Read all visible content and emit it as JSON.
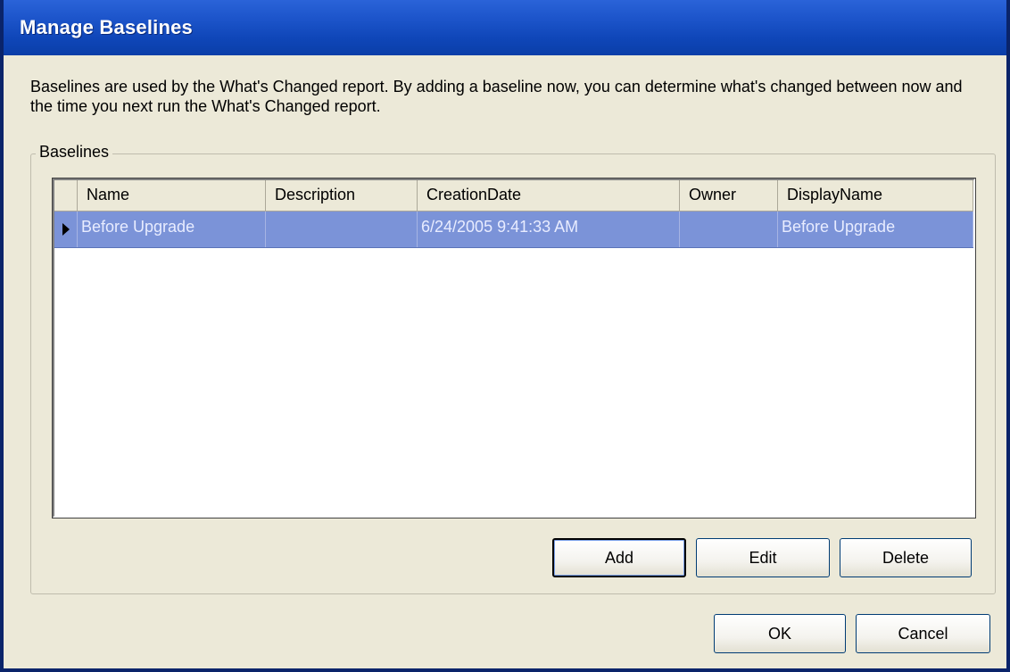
{
  "window": {
    "title": "Manage Baselines"
  },
  "intro": {
    "text": "Baselines are used by the What's Changed report.  By adding a baseline now, you can determine what's changed between now and the time you next run the What's Changed report."
  },
  "baselines_group": {
    "label": "Baselines",
    "columns": [
      "Name",
      "Description",
      "CreationDate",
      "Owner",
      "DisplayName"
    ],
    "rows": [
      {
        "name": "Before Upgrade",
        "description": "",
        "creation_date": "6/24/2005 9:41:33 AM",
        "owner": "",
        "display_name": "Before Upgrade",
        "selected": true
      }
    ],
    "buttons": {
      "add": "Add",
      "edit": "Edit",
      "delete": "Delete"
    }
  },
  "footer": {
    "ok": "OK",
    "cancel": "Cancel"
  },
  "colors": {
    "titlebar": "#0f46b8",
    "selection": "#7b93d8",
    "dialog_bg": "#ece9d8"
  }
}
